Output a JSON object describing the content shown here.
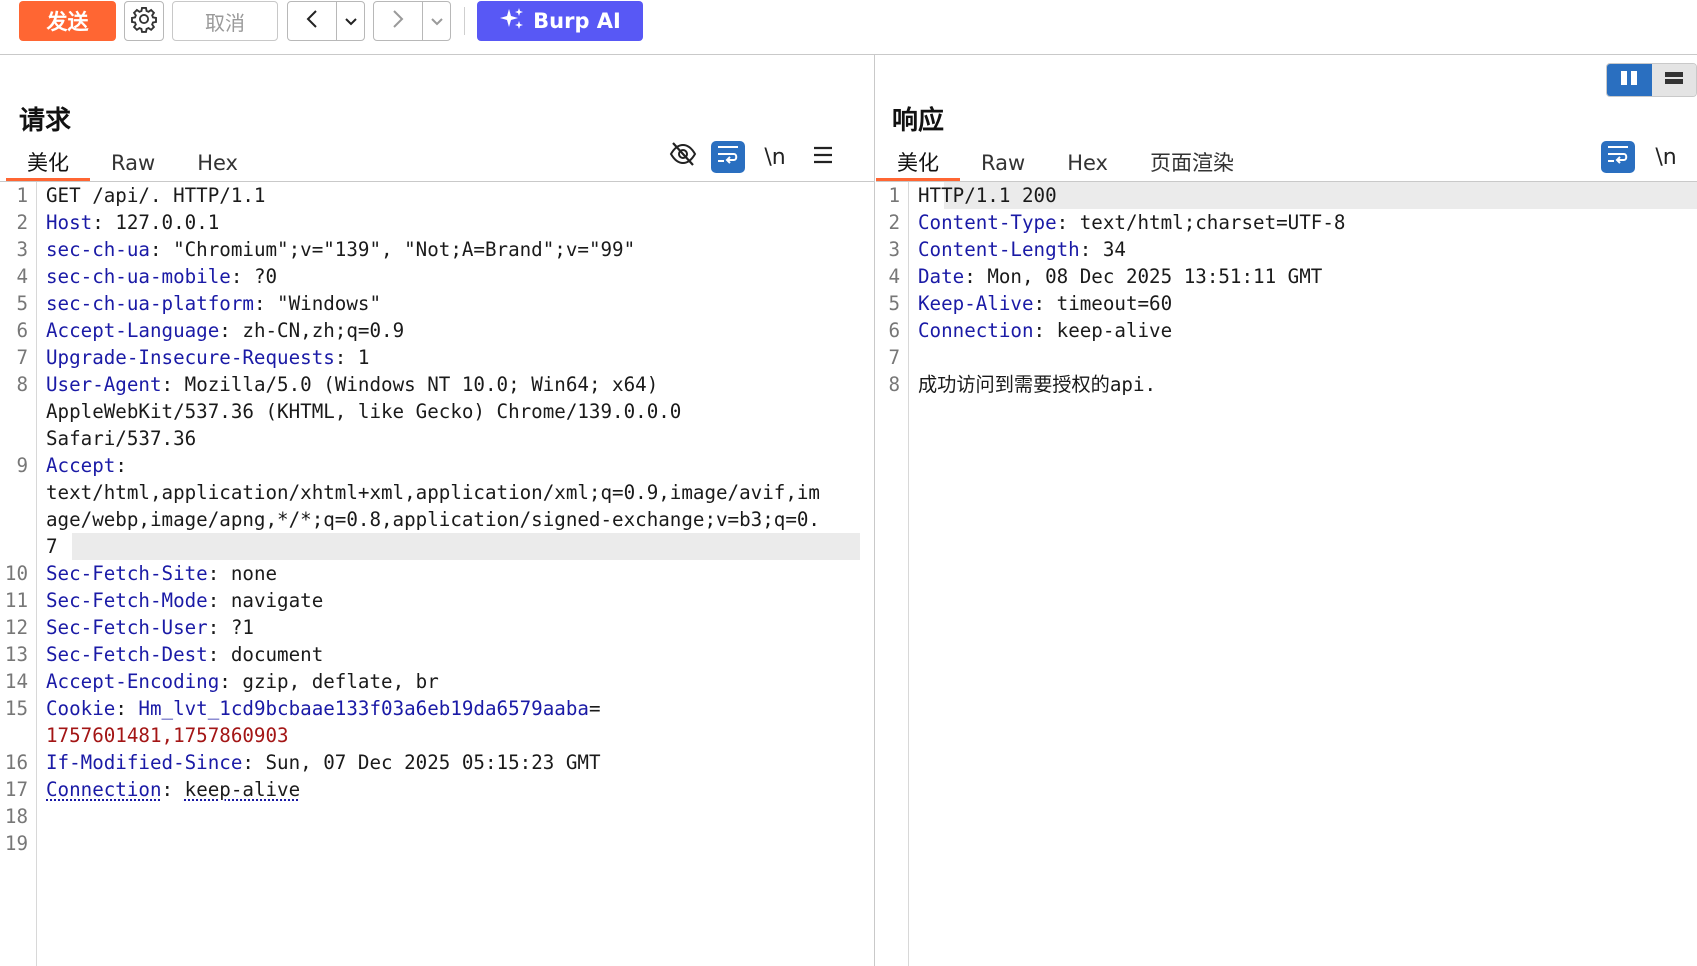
{
  "toolbar": {
    "send_label": "发送",
    "cancel_label": "取消",
    "burp_ai_label": "Burp AI",
    "icons": [
      "gear-icon",
      "chevron-left-icon",
      "chevron-down-icon",
      "chevron-right-icon",
      "sparkle-icon"
    ]
  },
  "request": {
    "title": "请求",
    "tabs": [
      "美化",
      "Raw",
      "Hex"
    ],
    "active_tab": "美化",
    "tools": {
      "newline_label": "\\n"
    },
    "lines": [
      {
        "n": "1",
        "key": "",
        "sep": "",
        "val": "GET /api/. HTTP/1.1"
      },
      {
        "n": "2",
        "key": "Host",
        "sep": ": ",
        "val": "127.0.0.1"
      },
      {
        "n": "3",
        "key": "sec-ch-ua",
        "sep": ": ",
        "val": "\"Chromium\";v=\"139\", \"Not;A=Brand\";v=\"99\""
      },
      {
        "n": "4",
        "key": "sec-ch-ua-mobile",
        "sep": ": ",
        "val": "?0"
      },
      {
        "n": "5",
        "key": "sec-ch-ua-platform",
        "sep": ": ",
        "val": "\"Windows\""
      },
      {
        "n": "6",
        "key": "Accept-Language",
        "sep": ": ",
        "val": "zh-CN,zh;q=0.9"
      },
      {
        "n": "7",
        "key": "Upgrade-Insecure-Requests",
        "sep": ": ",
        "val": "1"
      },
      {
        "n": "8",
        "key": "User-Agent",
        "sep": ": ",
        "val": "Mozilla/5.0 (Windows NT 10.0; Win64; x64)"
      },
      {
        "n": "",
        "key": "",
        "sep": "",
        "val": "AppleWebKit/537.36 (KHTML, like Gecko) Chrome/139.0.0.0"
      },
      {
        "n": "",
        "key": "",
        "sep": "",
        "val": "Safari/537.36"
      },
      {
        "n": "9",
        "key": "Accept",
        "sep": ":",
        "val": ""
      },
      {
        "n": "",
        "key": "",
        "sep": "",
        "val": "text/html,application/xhtml+xml,application/xml;q=0.9,image/avif,im"
      },
      {
        "n": "",
        "key": "",
        "sep": "",
        "val": "age/webp,image/apng,*/*;q=0.8,application/signed-exchange;v=b3;q=0."
      },
      {
        "n": "",
        "key": "",
        "sep": "",
        "val": "7"
      },
      {
        "n": "10",
        "key": "Sec-Fetch-Site",
        "sep": ": ",
        "val": "none"
      },
      {
        "n": "11",
        "key": "Sec-Fetch-Mode",
        "sep": ": ",
        "val": "navigate"
      },
      {
        "n": "12",
        "key": "Sec-Fetch-User",
        "sep": ": ",
        "val": "?1"
      },
      {
        "n": "13",
        "key": "Sec-Fetch-Dest",
        "sep": ": ",
        "val": "document"
      },
      {
        "n": "14",
        "key": "Accept-Encoding",
        "sep": ": ",
        "val": "gzip, deflate, br"
      },
      {
        "n": "15",
        "key": "Cookie",
        "sep": ": ",
        "val": "",
        "cookie_name": "Hm_lvt_1cd9bcbaae133f03a6eb19da6579aaba",
        "cookie_eq": "="
      },
      {
        "n": "",
        "key": "",
        "sep": "",
        "val": "",
        "cookie_value": "1757601481,1757860903"
      },
      {
        "n": "16",
        "key": "If-Modified-Since",
        "sep": ": ",
        "val": "Sun, 07 Dec 2025 05:15:23 GMT"
      },
      {
        "n": "17",
        "key": "Connection",
        "sep": ": ",
        "val": "keep-alive",
        "underline": true
      },
      {
        "n": "18",
        "key": "",
        "sep": "",
        "val": ""
      },
      {
        "n": "19",
        "key": "",
        "sep": "",
        "val": ""
      }
    ]
  },
  "response": {
    "title": "响应",
    "tabs": [
      "美化",
      "Raw",
      "Hex",
      "页面渲染"
    ],
    "active_tab": "美化",
    "tools": {
      "newline_label": "\\n"
    },
    "lines": [
      {
        "n": "1",
        "key": "",
        "sep": "",
        "val": "HTTP/1.1 200"
      },
      {
        "n": "2",
        "key": "Content-Type",
        "sep": ": ",
        "val": "text/html;charset=UTF-8"
      },
      {
        "n": "3",
        "key": "Content-Length",
        "sep": ": ",
        "val": "34"
      },
      {
        "n": "4",
        "key": "Date",
        "sep": ": ",
        "val": "Mon, 08 Dec 2025 13:51:11 GMT"
      },
      {
        "n": "5",
        "key": "Keep-Alive",
        "sep": ": ",
        "val": "timeout=60"
      },
      {
        "n": "6",
        "key": "Connection",
        "sep": ": ",
        "val": "keep-alive"
      },
      {
        "n": "7",
        "key": "",
        "sep": "",
        "val": ""
      },
      {
        "n": "8",
        "key": "",
        "sep": "",
        "val": "成功访问到需要授权的api."
      }
    ]
  },
  "colors": {
    "accent_orange": "#ff6633",
    "burp_ai_purple": "#5858f5",
    "header_key_blue": "#1a1aa6",
    "cookie_value_red": "#a31515",
    "tool_blue": "#2a6fc0"
  }
}
